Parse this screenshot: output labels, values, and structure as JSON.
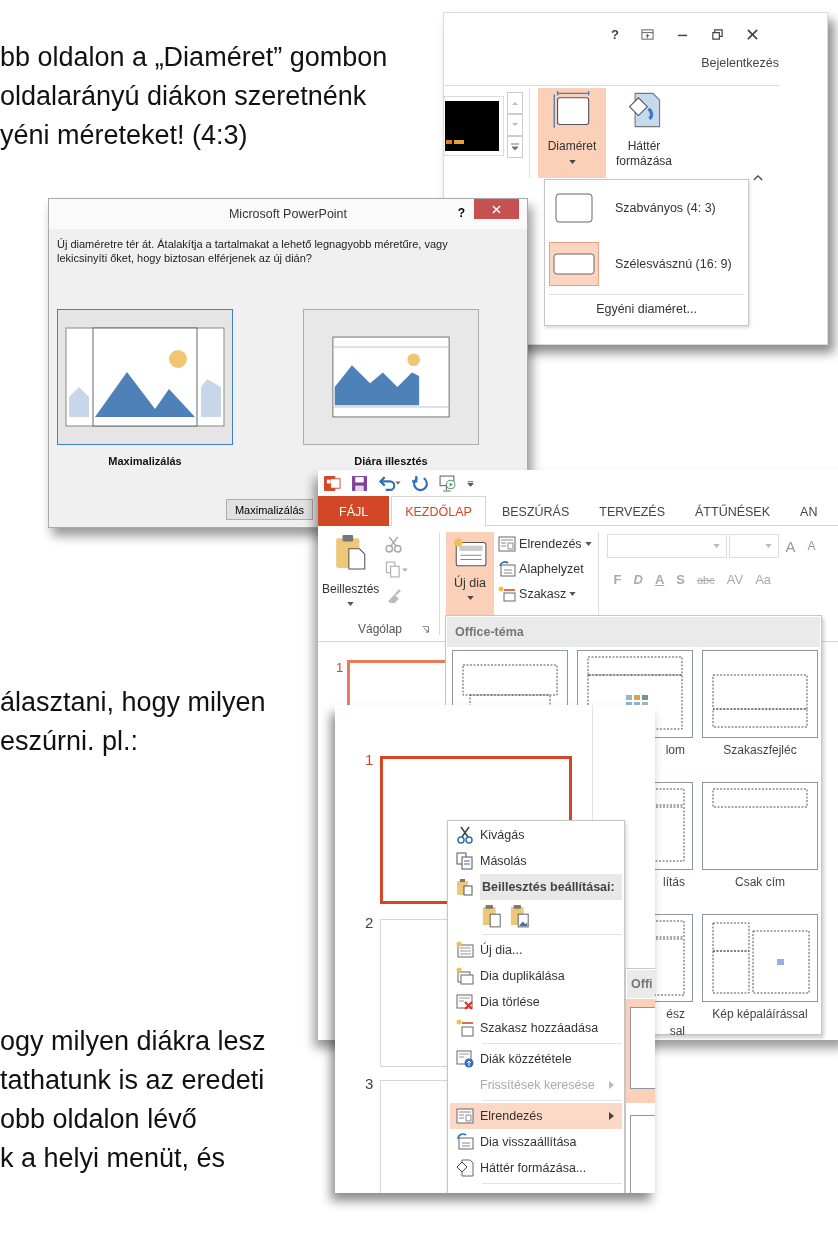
{
  "document": {
    "paragraphs": [
      {
        "text": "bb oldalon a „Diaméret” gombon\noldalarányú diákon szeretnénk\nyéni méreteket! (4:3)"
      },
      {
        "text": "álasztani, hogy milyen\neszúrni. pl.:"
      },
      {
        "text": "ogy milyen diákra lesz\ntathatunk is az eredeti\nobb oldalon lévő\nk a helyi menüt, és"
      }
    ]
  },
  "size_menu_screenshot": {
    "help": "?",
    "account": "Bejelentkezés",
    "buttons": [
      {
        "label": "Diaméret",
        "kind": "slide-size",
        "selected": true,
        "dropdown": true
      },
      {
        "label": "Háttér formázása",
        "kind": "format-background",
        "selected": false,
        "dropdown": false
      }
    ],
    "menu": {
      "items": [
        {
          "label": "Szabványos (4: 3)",
          "kind": "standard",
          "selected": false
        },
        {
          "label": "Szélesvásznú (16: 9)",
          "kind": "wide",
          "selected": true
        }
      ],
      "footer": "Egyéni diaméret..."
    }
  },
  "dialog": {
    "title": "Microsoft PowerPoint",
    "help": "?",
    "message": "Új diaméretre tér át. Átalakítja a tartalmakat a lehető legnagyobb méretűre, vagy lekicsinyíti őket, hogy biztosan elférjenek az új dián?",
    "options": [
      {
        "label": "Maximalizálás",
        "kind": "maximize",
        "selected": true
      },
      {
        "label": "Diára illesztés",
        "kind": "fit",
        "selected": false
      }
    ],
    "button": "Maximalizálás"
  },
  "ribbon_screenshot": {
    "tabs": [
      {
        "label": "FÁJL",
        "kind": "file",
        "selected": false
      },
      {
        "label": "KEZDŐLAP",
        "kind": "tab",
        "selected": true
      },
      {
        "label": "BESZÚRÁS",
        "kind": "tab",
        "selected": false
      },
      {
        "label": "TERVEZÉS",
        "kind": "tab",
        "selected": false
      },
      {
        "label": "ÁTTŰNÉSEK",
        "kind": "tab",
        "selected": false
      },
      {
        "label": "AN",
        "kind": "tab",
        "selected": false
      }
    ],
    "paste": "Beillesztés",
    "clipboard_group": "Vágólap",
    "new_slide": {
      "label": "Új dia",
      "selected": true
    },
    "slide_commands": [
      {
        "label": "Elrendezés",
        "kind": "layout",
        "dropdown": true
      },
      {
        "label": "Alaphelyzet",
        "kind": "reset",
        "dropdown": false
      },
      {
        "label": "Szakasz",
        "kind": "section",
        "dropdown": true
      }
    ],
    "font_size_buttons": [
      "A",
      "A"
    ],
    "format_buttons": [
      "F",
      "D",
      "A",
      "S",
      "abc",
      "AV",
      "Aa"
    ],
    "slide_number": "1",
    "gallery": {
      "header": "Office-téma",
      "rows": [
        [
          {
            "kind": "title"
          },
          {
            "kind": "content",
            "label": "lom",
            "cut": true
          },
          {
            "kind": "section",
            "label": "Szakaszfejléc",
            "cut": false
          }
        ],
        [
          "",
          {
            "kind": "two-content",
            "label": "lítás",
            "cut": true
          },
          {
            "kind": "title-only",
            "label": "Csak cím",
            "cut": false
          }
        ],
        [
          "",
          {
            "kind": "comparison",
            "label": "ész\nsal",
            "cut": true
          },
          {
            "kind": "picture-caption",
            "label": "Kép képaláírással",
            "cut": false
          }
        ]
      ]
    }
  },
  "context_menu_screenshot": {
    "slides": [
      {
        "number": "1",
        "selected": true
      },
      {
        "number": "2",
        "selected": false
      },
      {
        "number": "3",
        "selected": false
      }
    ],
    "menu": [
      {
        "kind": "item",
        "label": "Kivágás",
        "disabled": false,
        "highlighted": false,
        "submenu": false
      },
      {
        "kind": "item",
        "label": "Másolás",
        "disabled": false,
        "highlighted": false,
        "submenu": false
      },
      {
        "kind": "header",
        "label": "Beillesztés beállításai:"
      },
      {
        "kind": "paste-options"
      },
      {
        "kind": "separator"
      },
      {
        "kind": "item",
        "label": "Új dia...",
        "disabled": false,
        "highlighted": false,
        "submenu": false
      },
      {
        "kind": "item",
        "label": "Dia duplikálása",
        "disabled": false,
        "highlighted": false,
        "submenu": false
      },
      {
        "kind": "item",
        "label": "Dia törlése",
        "disabled": false,
        "highlighted": false,
        "submenu": false
      },
      {
        "kind": "item",
        "label": "Szakasz hozzáadása",
        "disabled": false,
        "highlighted": false,
        "submenu": false
      },
      {
        "kind": "separator"
      },
      {
        "kind": "item",
        "label": "Diák közzététele",
        "disabled": false,
        "highlighted": false,
        "submenu": false
      },
      {
        "kind": "item",
        "label": "Frissítések keresése",
        "disabled": true,
        "highlighted": false,
        "submenu": true
      },
      {
        "kind": "separator"
      },
      {
        "kind": "item",
        "label": "Elrendezés",
        "disabled": false,
        "highlighted": true,
        "submenu": true
      },
      {
        "kind": "item",
        "label": "Dia visszaállítása",
        "disabled": false,
        "highlighted": false,
        "submenu": false
      },
      {
        "kind": "item",
        "label": "Háttér formázása...",
        "disabled": false,
        "highlighted": false,
        "submenu": false
      },
      {
        "kind": "separator"
      }
    ],
    "submenu_header": "Offi"
  }
}
